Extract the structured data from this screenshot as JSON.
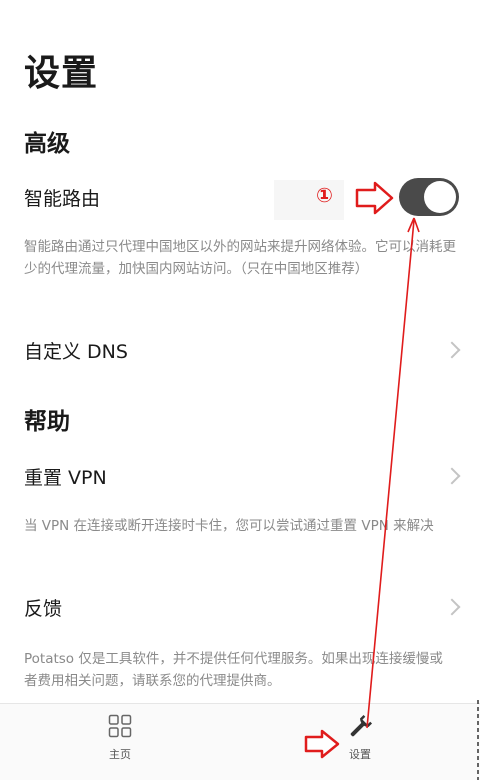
{
  "header": {
    "title": "设置"
  },
  "advanced": {
    "heading": "高级",
    "smart_route_label": "智能路由",
    "smart_route_on": true,
    "smart_route_desc": "智能路由通过只代理中国地区以外的网站来提升网络体验。它可以消耗更少的代理流量，加快国内网站访问。（只在中国地区推荐）",
    "custom_dns_label": "自定义 DNS"
  },
  "help": {
    "heading": "帮助",
    "reset_vpn_label": "重置 VPN",
    "reset_vpn_desc": "当 VPN 在连接或断开连接时卡住，您可以尝试通过重置 VPN 来解决",
    "feedback_label": "反馈",
    "feedback_desc": "Potatso 仅是工具软件，并不提供任何代理服务。如果出现连接缓慢或者费用相关问题，请联系您的代理提供商。"
  },
  "tabbar": {
    "home_label": "主页",
    "settings_label": "设置"
  },
  "annotation": {
    "step_marker": "①",
    "color": "#e01c1c"
  },
  "colors": {
    "toggle_on": "#4a4a4a",
    "desc_text": "#8a8a8a"
  }
}
